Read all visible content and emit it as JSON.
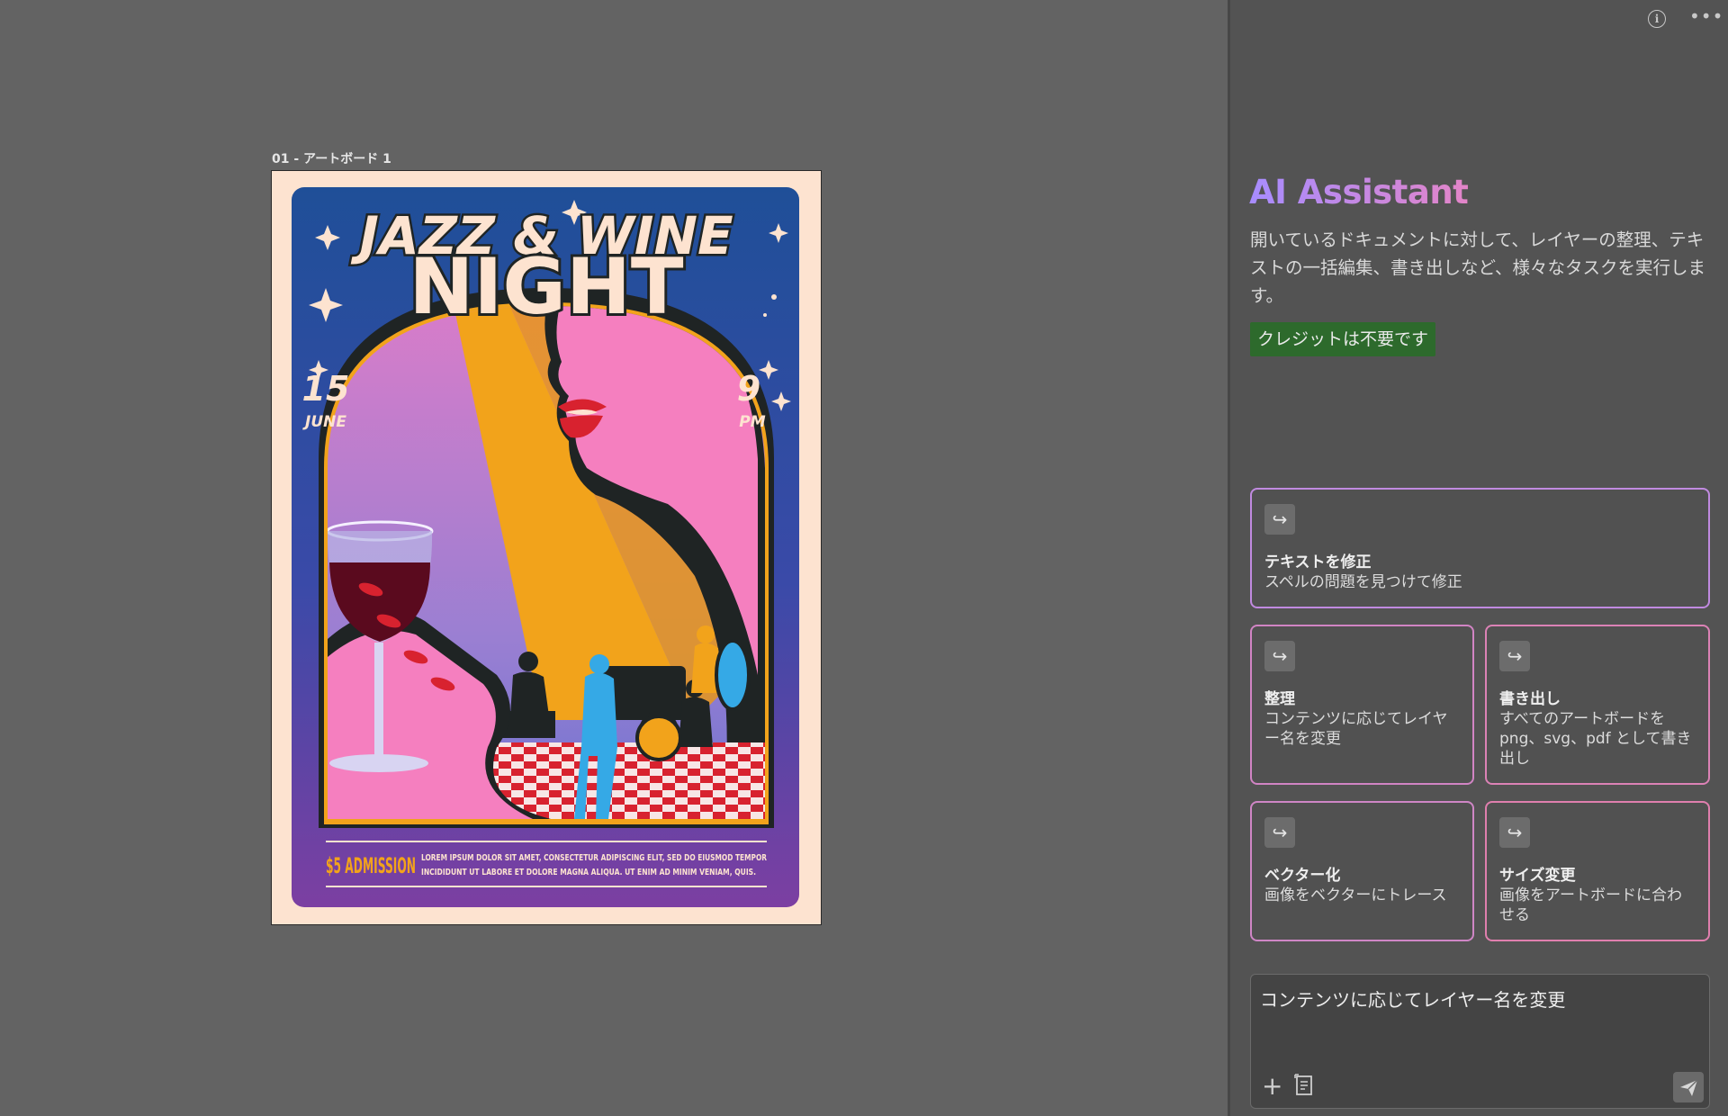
{
  "canvas": {
    "artboard_label": "01 - アートボード 1",
    "poster": {
      "title_line1": "JAZZ & WINE",
      "title_line2": "NIGHT",
      "date_day": "15",
      "date_month": "JUNE",
      "time_hour": "9",
      "time_ampm": "PM",
      "admission": "$5 ADMISSION",
      "body_line1": "LOREM IPSUM DOLOR SIT AMET, CONSECTETUR ADIPISCING ELIT, SED DO EIUSMOD TEMPOR",
      "body_line2": "INCIDIDUNT UT LABORE ET DOLORE MAGNA ALIQUA. UT ENIM AD MINIM VENIAM, QUIS.",
      "colors": {
        "background": "#fde3d0",
        "frame_top": "#23509a",
        "frame_bottom": "#7d3fa0",
        "title": "#fde3d0",
        "pink": "#f57fbf",
        "orange": "#f2a31b",
        "blue_musician": "#35a9e6",
        "dark": "#1f2424",
        "wine": "#5a0a1e",
        "checker_red": "#d8222f"
      }
    }
  },
  "panel": {
    "title": "AI Assistant",
    "description": "開いているドキュメントに対して、レイヤーの整理、テキストの一括編集、書き出しなど、様々なタスクを実行します。",
    "credit_badge": "クレジットは不要です",
    "icons": {
      "info": "info-icon",
      "more": "more-icon"
    },
    "cards": [
      {
        "title": "テキストを修正",
        "desc": "スペルの問題を見つけて修正",
        "icon": "redirect-arrow-icon"
      },
      {
        "title": "整理",
        "desc": "コンテンツに応じてレイヤー名を変更",
        "icon": "redirect-arrow-icon"
      },
      {
        "title": "書き出し",
        "desc": "すべてのアートボードをpng、svg、pdf として書き出し",
        "icon": "redirect-arrow-icon"
      },
      {
        "title": "ベクター化",
        "desc": "画像をベクターにトレース",
        "icon": "redirect-arrow-icon"
      },
      {
        "title": "サイズ変更",
        "desc": "画像をアートボードに合わせる",
        "icon": "redirect-arrow-icon"
      }
    ],
    "input": {
      "value": "コンテンツに応じてレイヤー名を変更"
    }
  }
}
